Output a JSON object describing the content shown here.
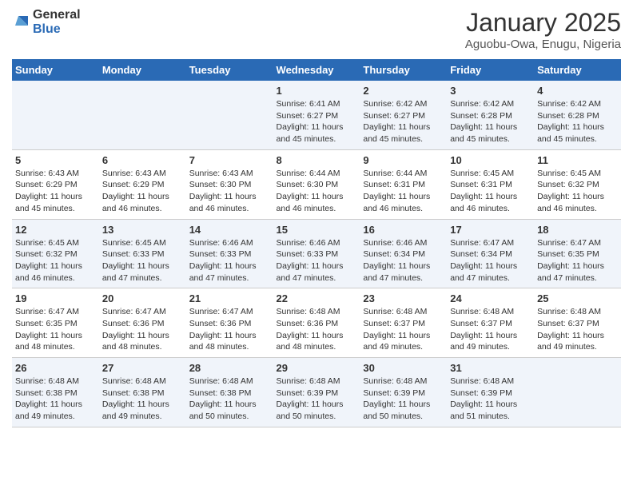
{
  "header": {
    "logo_general": "General",
    "logo_blue": "Blue",
    "month_title": "January 2025",
    "subtitle": "Aguobu-Owa, Enugu, Nigeria"
  },
  "days_of_week": [
    "Sunday",
    "Monday",
    "Tuesday",
    "Wednesday",
    "Thursday",
    "Friday",
    "Saturday"
  ],
  "weeks": [
    [
      {
        "day": null,
        "info": null
      },
      {
        "day": null,
        "info": null
      },
      {
        "day": null,
        "info": null
      },
      {
        "day": "1",
        "info": "Sunrise: 6:41 AM\nSunset: 6:27 PM\nDaylight: 11 hours and 45 minutes."
      },
      {
        "day": "2",
        "info": "Sunrise: 6:42 AM\nSunset: 6:27 PM\nDaylight: 11 hours and 45 minutes."
      },
      {
        "day": "3",
        "info": "Sunrise: 6:42 AM\nSunset: 6:28 PM\nDaylight: 11 hours and 45 minutes."
      },
      {
        "day": "4",
        "info": "Sunrise: 6:42 AM\nSunset: 6:28 PM\nDaylight: 11 hours and 45 minutes."
      }
    ],
    [
      {
        "day": "5",
        "info": "Sunrise: 6:43 AM\nSunset: 6:29 PM\nDaylight: 11 hours and 45 minutes."
      },
      {
        "day": "6",
        "info": "Sunrise: 6:43 AM\nSunset: 6:29 PM\nDaylight: 11 hours and 46 minutes."
      },
      {
        "day": "7",
        "info": "Sunrise: 6:43 AM\nSunset: 6:30 PM\nDaylight: 11 hours and 46 minutes."
      },
      {
        "day": "8",
        "info": "Sunrise: 6:44 AM\nSunset: 6:30 PM\nDaylight: 11 hours and 46 minutes."
      },
      {
        "day": "9",
        "info": "Sunrise: 6:44 AM\nSunset: 6:31 PM\nDaylight: 11 hours and 46 minutes."
      },
      {
        "day": "10",
        "info": "Sunrise: 6:45 AM\nSunset: 6:31 PM\nDaylight: 11 hours and 46 minutes."
      },
      {
        "day": "11",
        "info": "Sunrise: 6:45 AM\nSunset: 6:32 PM\nDaylight: 11 hours and 46 minutes."
      }
    ],
    [
      {
        "day": "12",
        "info": "Sunrise: 6:45 AM\nSunset: 6:32 PM\nDaylight: 11 hours and 46 minutes."
      },
      {
        "day": "13",
        "info": "Sunrise: 6:45 AM\nSunset: 6:33 PM\nDaylight: 11 hours and 47 minutes."
      },
      {
        "day": "14",
        "info": "Sunrise: 6:46 AM\nSunset: 6:33 PM\nDaylight: 11 hours and 47 minutes."
      },
      {
        "day": "15",
        "info": "Sunrise: 6:46 AM\nSunset: 6:33 PM\nDaylight: 11 hours and 47 minutes."
      },
      {
        "day": "16",
        "info": "Sunrise: 6:46 AM\nSunset: 6:34 PM\nDaylight: 11 hours and 47 minutes."
      },
      {
        "day": "17",
        "info": "Sunrise: 6:47 AM\nSunset: 6:34 PM\nDaylight: 11 hours and 47 minutes."
      },
      {
        "day": "18",
        "info": "Sunrise: 6:47 AM\nSunset: 6:35 PM\nDaylight: 11 hours and 47 minutes."
      }
    ],
    [
      {
        "day": "19",
        "info": "Sunrise: 6:47 AM\nSunset: 6:35 PM\nDaylight: 11 hours and 48 minutes."
      },
      {
        "day": "20",
        "info": "Sunrise: 6:47 AM\nSunset: 6:36 PM\nDaylight: 11 hours and 48 minutes."
      },
      {
        "day": "21",
        "info": "Sunrise: 6:47 AM\nSunset: 6:36 PM\nDaylight: 11 hours and 48 minutes."
      },
      {
        "day": "22",
        "info": "Sunrise: 6:48 AM\nSunset: 6:36 PM\nDaylight: 11 hours and 48 minutes."
      },
      {
        "day": "23",
        "info": "Sunrise: 6:48 AM\nSunset: 6:37 PM\nDaylight: 11 hours and 49 minutes."
      },
      {
        "day": "24",
        "info": "Sunrise: 6:48 AM\nSunset: 6:37 PM\nDaylight: 11 hours and 49 minutes."
      },
      {
        "day": "25",
        "info": "Sunrise: 6:48 AM\nSunset: 6:37 PM\nDaylight: 11 hours and 49 minutes."
      }
    ],
    [
      {
        "day": "26",
        "info": "Sunrise: 6:48 AM\nSunset: 6:38 PM\nDaylight: 11 hours and 49 minutes."
      },
      {
        "day": "27",
        "info": "Sunrise: 6:48 AM\nSunset: 6:38 PM\nDaylight: 11 hours and 49 minutes."
      },
      {
        "day": "28",
        "info": "Sunrise: 6:48 AM\nSunset: 6:38 PM\nDaylight: 11 hours and 50 minutes."
      },
      {
        "day": "29",
        "info": "Sunrise: 6:48 AM\nSunset: 6:39 PM\nDaylight: 11 hours and 50 minutes."
      },
      {
        "day": "30",
        "info": "Sunrise: 6:48 AM\nSunset: 6:39 PM\nDaylight: 11 hours and 50 minutes."
      },
      {
        "day": "31",
        "info": "Sunrise: 6:48 AM\nSunset: 6:39 PM\nDaylight: 11 hours and 51 minutes."
      },
      {
        "day": null,
        "info": null
      }
    ]
  ]
}
